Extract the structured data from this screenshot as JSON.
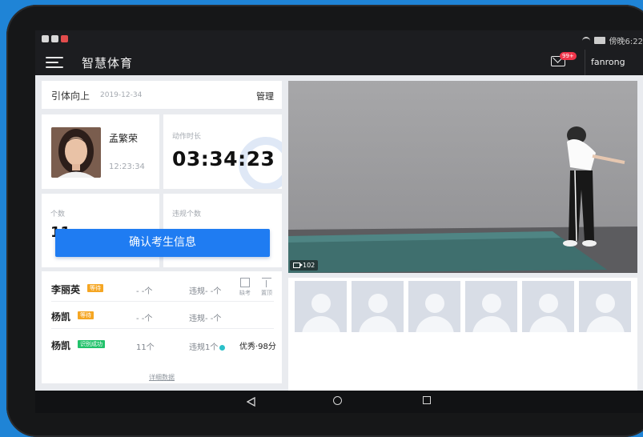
{
  "status_bar": {
    "clock": "傍晚6:22"
  },
  "app": {
    "title": "智慧体育",
    "mail_badge": "99+",
    "username": "fanrong"
  },
  "exam": {
    "name": "引体向上",
    "date": "2019-12-34",
    "manage_label": "管理"
  },
  "student": {
    "name": "孟繁荣",
    "time": "12:23:34"
  },
  "duration": {
    "label": "动作时长",
    "value": "03:34:23"
  },
  "count": {
    "label": "个数",
    "value": "11"
  },
  "violations": {
    "label": "违规个数"
  },
  "confirm_button": "确认考生信息",
  "roster": [
    {
      "name": "李丽英",
      "tag": "等待",
      "count": "- -个",
      "violation": "违规- -个",
      "absent_label": "缺考",
      "pin_label": "置顶"
    },
    {
      "name": "杨凯",
      "tag": "等待",
      "count": "- -个",
      "violation": "违规- -个"
    },
    {
      "name": "杨凯",
      "tag": "识别成功",
      "count": "11个",
      "violation": "违规1个",
      "score": "优秀·98分"
    }
  ],
  "detail_link": "详细数据",
  "video": {
    "camera_id": "102"
  },
  "colors": {
    "primary": "#1f7cf2",
    "header": "#1c1d20",
    "tag_wait": "#f5a623",
    "tag_ok": "#22c26b",
    "badge": "#f0354a"
  }
}
